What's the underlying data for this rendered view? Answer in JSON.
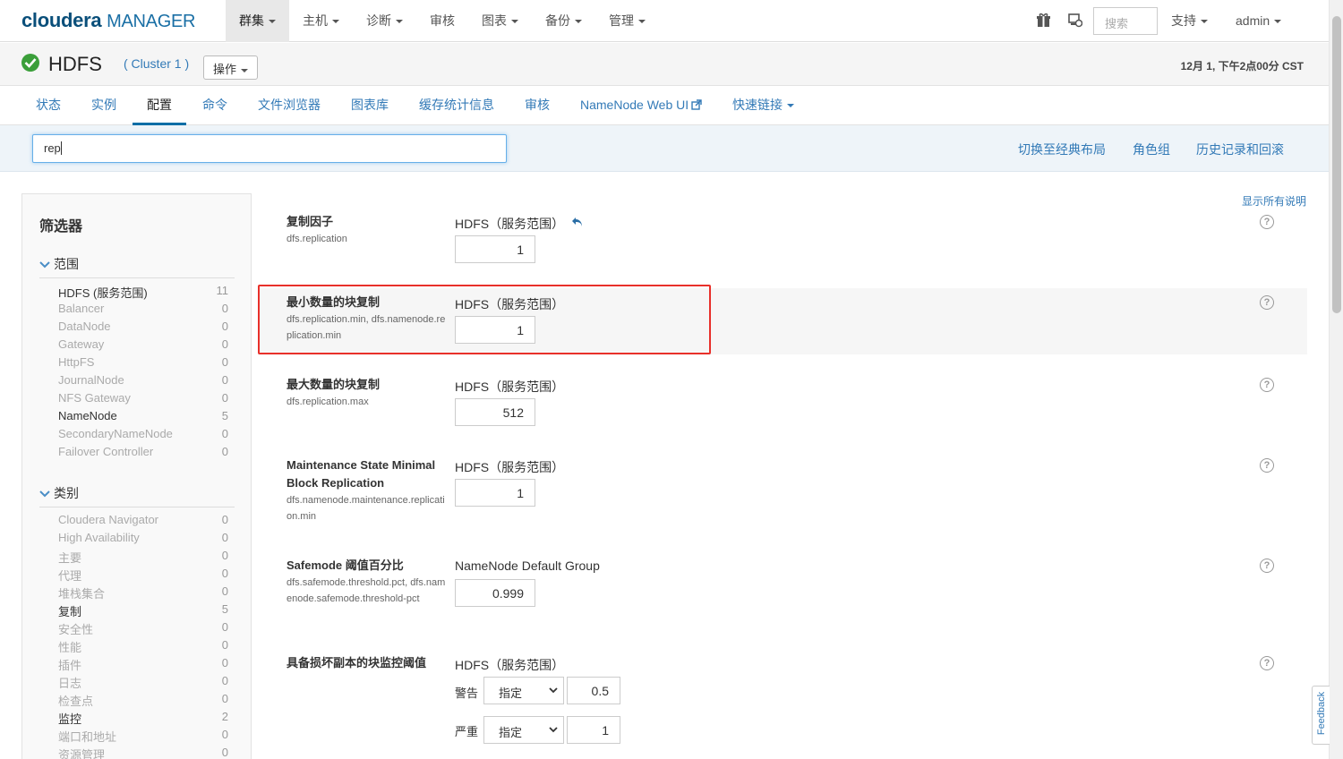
{
  "brand": {
    "logo_main": "cloudera",
    "logo_sub": "MANAGER"
  },
  "nav": {
    "items": [
      {
        "label": "群集"
      },
      {
        "label": "主机"
      },
      {
        "label": "诊断"
      },
      {
        "label": "审核"
      },
      {
        "label": "图表"
      },
      {
        "label": "备份"
      },
      {
        "label": "管理"
      }
    ],
    "search_placeholder": "搜索",
    "support_label": "支持",
    "user_label": "admin"
  },
  "service": {
    "name": "HDFS",
    "cluster": "( Cluster 1 )",
    "actions_label": "操作",
    "timestamp": "12月 1, 下午2点00分 CST",
    "status_color": "#3b9f3a"
  },
  "tabs": [
    {
      "label": "状态"
    },
    {
      "label": "实例"
    },
    {
      "label": "配置"
    },
    {
      "label": "命令"
    },
    {
      "label": "文件浏览器"
    },
    {
      "label": "图表库"
    },
    {
      "label": "缓存统计信息"
    },
    {
      "label": "审核"
    },
    {
      "label": "NameNode Web UI"
    },
    {
      "label": "快速链接"
    }
  ],
  "search": {
    "value": "rep",
    "links": [
      "切换至经典布局",
      "角色组",
      "历史记录和回滚"
    ]
  },
  "filter": {
    "title": "筛选器",
    "scope_group": "范围",
    "scope_items": [
      {
        "label": "HDFS (服务范围)",
        "count": "11"
      },
      {
        "label": "Balancer",
        "count": "0"
      },
      {
        "label": "DataNode",
        "count": "0"
      },
      {
        "label": "Gateway",
        "count": "0"
      },
      {
        "label": "HttpFS",
        "count": "0"
      },
      {
        "label": "JournalNode",
        "count": "0"
      },
      {
        "label": "NFS Gateway",
        "count": "0"
      },
      {
        "label": "NameNode",
        "count": "5"
      },
      {
        "label": "SecondaryNameNode",
        "count": "0"
      },
      {
        "label": "Failover Controller",
        "count": "0"
      }
    ],
    "category_group": "类别",
    "category_items": [
      {
        "label": "Cloudera Navigator",
        "count": "0"
      },
      {
        "label": "High Availability",
        "count": "0"
      },
      {
        "label": "主要",
        "count": "0"
      },
      {
        "label": "代理",
        "count": "0"
      },
      {
        "label": "堆栈集合",
        "count": "0"
      },
      {
        "label": "复制",
        "count": "5"
      },
      {
        "label": "安全性",
        "count": "0"
      },
      {
        "label": "性能",
        "count": "0"
      },
      {
        "label": "插件",
        "count": "0"
      },
      {
        "label": "日志",
        "count": "0"
      },
      {
        "label": "检查点",
        "count": "0"
      },
      {
        "label": "监控",
        "count": "2"
      },
      {
        "label": "端口和地址",
        "count": "0"
      },
      {
        "label": "资源管理",
        "count": "0"
      }
    ]
  },
  "config": {
    "show_all_desc": "显示所有说明",
    "rows": [
      {
        "label": "复制因子",
        "key": "dfs.replication",
        "scope": "HDFS（服务范围）",
        "value": "1"
      },
      {
        "label": "最小数量的块复制",
        "key": "dfs.replication.min, dfs.namenode.replication.min",
        "scope": "HDFS（服务范围）",
        "value": "1"
      },
      {
        "label": "最大数量的块复制",
        "key": "dfs.replication.max",
        "scope": "HDFS（服务范围）",
        "value": "512"
      },
      {
        "label": "Maintenance State Minimal Block Replication",
        "key": "dfs.namenode.maintenance.replication.min",
        "scope": "HDFS（服务范围）",
        "value": "1"
      },
      {
        "label": "Safemode 阈值百分比",
        "key": "dfs.safemode.threshold.pct, dfs.namenode.safemode.threshold-pct",
        "scope": "NameNode Default Group",
        "value": "0.999"
      },
      {
        "label": "具备损坏副本的块监控阈值",
        "key": "",
        "scope": "HDFS（服务范围）",
        "value": ""
      }
    ],
    "threshold": {
      "warning_label": "警告",
      "warning_mode": "指定",
      "warning_value": "0.5",
      "critical_label": "严重",
      "critical_mode": "指定",
      "critical_value": "1"
    }
  },
  "feedback_label": "Feedback",
  "highlight_color": "#e8302a"
}
